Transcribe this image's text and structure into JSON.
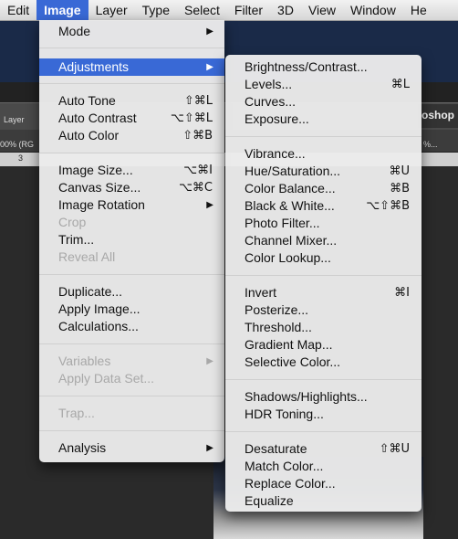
{
  "menubar": {
    "items": [
      "Edit",
      "Image",
      "Layer",
      "Type",
      "Select",
      "Filter",
      "3D",
      "View",
      "Window",
      "He"
    ]
  },
  "workspace": {
    "tab_right": "oshop",
    "layer_label": "Layer",
    "zoom_label": "00% (RG",
    "zoom_label_right": "%...",
    "ruler_number": "3"
  },
  "image_menu": {
    "mode": "Mode",
    "adjustments": "Adjustments",
    "auto_tone": {
      "label": "Auto Tone",
      "shortcut": "⇧⌘L"
    },
    "auto_contrast": {
      "label": "Auto Contrast",
      "shortcut": "⌥⇧⌘L"
    },
    "auto_color": {
      "label": "Auto Color",
      "shortcut": "⇧⌘B"
    },
    "image_size": {
      "label": "Image Size...",
      "shortcut": "⌥⌘I"
    },
    "canvas_size": {
      "label": "Canvas Size...",
      "shortcut": "⌥⌘C"
    },
    "image_rotation": "Image Rotation",
    "crop": "Crop",
    "trim": "Trim...",
    "reveal_all": "Reveal All",
    "duplicate": "Duplicate...",
    "apply_image": "Apply Image...",
    "calculations": "Calculations...",
    "variables": "Variables",
    "apply_data_set": "Apply Data Set...",
    "trap": "Trap...",
    "analysis": "Analysis"
  },
  "adjustments_menu": {
    "brightness_contrast": {
      "label": "Brightness/Contrast...",
      "shortcut": ""
    },
    "levels": {
      "label": "Levels...",
      "shortcut": "⌘L"
    },
    "curves": {
      "label": "Curves...",
      "shortcut": ""
    },
    "exposure": {
      "label": "Exposure...",
      "shortcut": ""
    },
    "vibrance": {
      "label": "Vibrance...",
      "shortcut": ""
    },
    "hue_saturation": {
      "label": "Hue/Saturation...",
      "shortcut": "⌘U"
    },
    "color_balance": {
      "label": "Color Balance...",
      "shortcut": "⌘B"
    },
    "black_white": {
      "label": "Black & White...",
      "shortcut": "⌥⇧⌘B"
    },
    "photo_filter": {
      "label": "Photo Filter...",
      "shortcut": ""
    },
    "channel_mixer": {
      "label": "Channel Mixer...",
      "shortcut": ""
    },
    "color_lookup": {
      "label": "Color Lookup...",
      "shortcut": ""
    },
    "invert": {
      "label": "Invert",
      "shortcut": "⌘I"
    },
    "posterize": {
      "label": "Posterize...",
      "shortcut": ""
    },
    "threshold": {
      "label": "Threshold...",
      "shortcut": ""
    },
    "gradient_map": {
      "label": "Gradient Map...",
      "shortcut": ""
    },
    "selective_color": {
      "label": "Selective Color...",
      "shortcut": ""
    },
    "shadows_highlights": {
      "label": "Shadows/Highlights...",
      "shortcut": ""
    },
    "hdr_toning": {
      "label": "HDR Toning...",
      "shortcut": ""
    },
    "desaturate": {
      "label": "Desaturate",
      "shortcut": "⇧⌘U"
    },
    "match_color": {
      "label": "Match Color...",
      "shortcut": ""
    },
    "replace_color": {
      "label": "Replace Color...",
      "shortcut": ""
    },
    "equalize": {
      "label": "Equalize",
      "shortcut": ""
    }
  },
  "colors": {
    "highlight": "#3969d6",
    "menu_bg": "#ececec",
    "disabled_text": "#a8a8a8"
  }
}
